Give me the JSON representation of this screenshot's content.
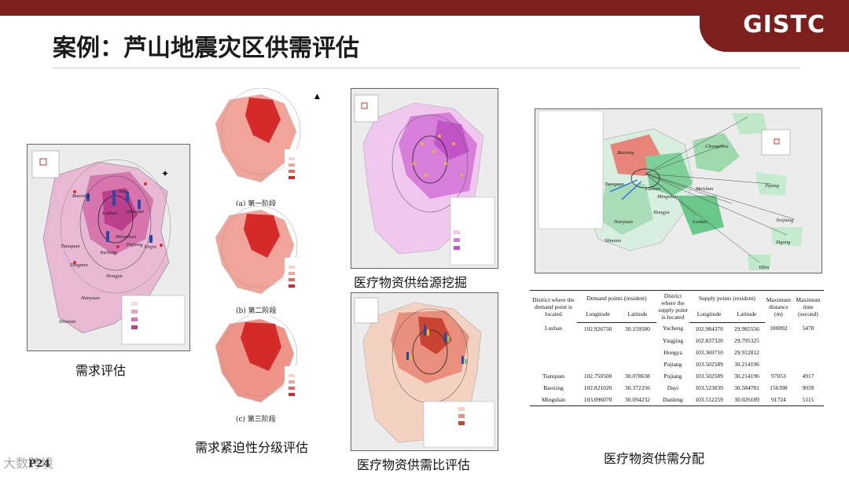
{
  "header": {
    "title": "案例：芦山地震灾区供需评估",
    "logo": "GISTC"
  },
  "panels": {
    "demand": {
      "caption": "需求评估",
      "compass": "N"
    },
    "urgency": {
      "caption": "需求紧迫性分级评估",
      "stage_a": "(a)  第一阶段",
      "stage_b": "(b)  第二阶段",
      "stage_c": "(c)  第三阶段"
    },
    "source": {
      "caption": "医疗物资供给源挖掘"
    },
    "ratio": {
      "caption": "医疗物资供需比评估"
    },
    "allocation": {
      "caption": "医疗物资供需分配"
    }
  },
  "map_labels": {
    "demand": [
      "Baoxing",
      "Dayi",
      "Lushan",
      "Qionglai",
      "Tianquan",
      "Mingshan",
      "Yucheng",
      "Pujiang",
      "Xinjin",
      "Dingmin",
      "Hanyuan",
      "Shimian",
      "Hongya"
    ],
    "allocation": [
      "Baoxing",
      "Chongzhou",
      "Tianquan",
      "Lushan",
      "Mingshan",
      "Meishan",
      "Ziyang",
      "Hanyuan",
      "Shimian",
      "Leshan",
      "Neijiang",
      "Zigong",
      "Yibin",
      "Hongya"
    ]
  },
  "table": {
    "headers": {
      "district": "District where the demand point is located",
      "demand": "Demand points (resident)",
      "longitude": "Longitude",
      "latitude": "Latitude",
      "supply_district": "District where the supply point is located",
      "supply": "Supply points (resident)",
      "s_longitude": "Longitude",
      "s_latitude": "Latitude",
      "max_distance": "Maximum distance (m)",
      "max_time": "Maximum time (second)"
    },
    "rows": [
      {
        "district": "Lushan",
        "lon": "102.926730",
        "lat": "30.159580",
        "supply_district": "Yucheng",
        "s_lon": "102.984370",
        "s_lat": "29.985556",
        "dist": "100092",
        "time": "5478"
      },
      {
        "district": "",
        "lon": "",
        "lat": "",
        "supply_district": "Yingjing",
        "s_lon": "102.837320",
        "s_lat": "29.795325",
        "dist": "",
        "time": ""
      },
      {
        "district": "",
        "lon": "",
        "lat": "",
        "supply_district": "Hongya",
        "s_lon": "103.369710",
        "s_lat": "29.912812",
        "dist": "",
        "time": ""
      },
      {
        "district": "",
        "lon": "",
        "lat": "",
        "supply_district": "Pujiang",
        "s_lon": "103.502589",
        "s_lat": "30.214196",
        "dist": "",
        "time": ""
      },
      {
        "district": "Tianquan",
        "lon": "102.750500",
        "lat": "30.078638",
        "supply_district": "Pujiang",
        "s_lon": "103.502589",
        "s_lat": "30.214196",
        "dist": "97053",
        "time": "4917"
      },
      {
        "district": "Baoxing",
        "lon": "102.821020",
        "lat": "30.372356",
        "supply_district": "Dayi",
        "s_lon": "103.523039",
        "s_lat": "30.584781",
        "dist": "156398",
        "time": "9039"
      },
      {
        "district": "Mingshan",
        "lon": "103.096070",
        "lat": "30.094232",
        "supply_district": "Danleng",
        "s_lon": "103.512259",
        "s_lat": "30.026189",
        "dist": "91724",
        "time": "5115"
      }
    ]
  },
  "footer": {
    "page": "P24",
    "watermark": "大数跨境"
  },
  "colors": {
    "brand": "#7d1f1c",
    "pink": "#e79fc2",
    "red": "#d9453a",
    "purple": "#c86fd0",
    "green": "#7fcf98"
  }
}
